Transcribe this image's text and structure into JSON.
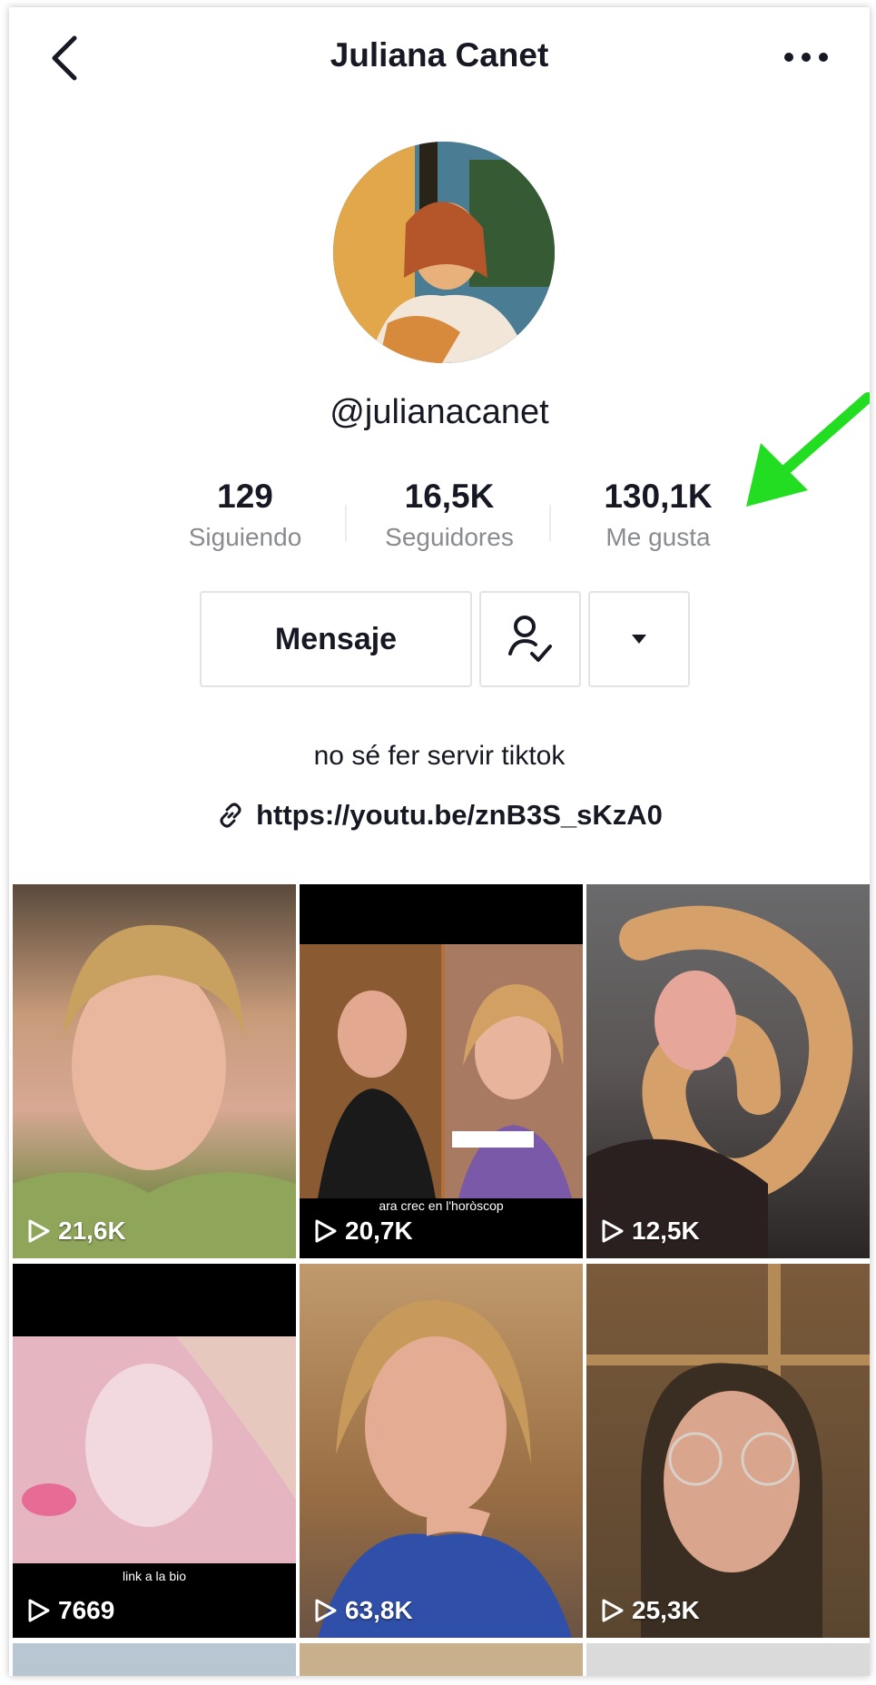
{
  "header": {
    "title": "Juliana Canet"
  },
  "profile": {
    "handle": "@julianacanet",
    "bio": "no sé fer servir tiktok",
    "link": "https://youtu.be/znB3S_sKzA0"
  },
  "stats": [
    {
      "value": "129",
      "label": "Siguiendo"
    },
    {
      "value": "16,5K",
      "label": "Seguidores"
    },
    {
      "value": "130,1K",
      "label": "Me gusta"
    }
  ],
  "actions": {
    "message_label": "Mensaje"
  },
  "annotation": {
    "arrow_color": "#22dd22"
  },
  "videos": [
    {
      "views": "21,6K",
      "caption": ""
    },
    {
      "views": "20,7K",
      "caption": "ara crec en l'horòscop"
    },
    {
      "views": "12,5K",
      "caption": ""
    },
    {
      "views": "7669",
      "caption": "link a la bio"
    },
    {
      "views": "63,8K",
      "caption": ""
    },
    {
      "views": "25,3K",
      "caption": ""
    }
  ]
}
